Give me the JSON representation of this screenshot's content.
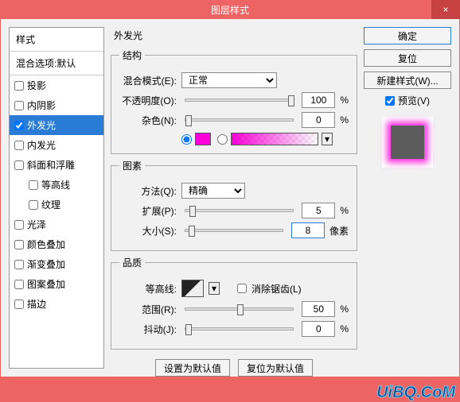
{
  "title": "图层样式",
  "close_glyph": "×",
  "left": {
    "header": "样式",
    "blend_row": "混合选项:默认",
    "items": [
      {
        "label": "投影",
        "checked": false,
        "selected": false,
        "indent": false
      },
      {
        "label": "内阴影",
        "checked": false,
        "selected": false,
        "indent": false
      },
      {
        "label": "外发光",
        "checked": true,
        "selected": true,
        "indent": false
      },
      {
        "label": "内发光",
        "checked": false,
        "selected": false,
        "indent": false
      },
      {
        "label": "斜面和浮雕",
        "checked": false,
        "selected": false,
        "indent": false
      },
      {
        "label": "等高线",
        "checked": false,
        "selected": false,
        "indent": true
      },
      {
        "label": "纹理",
        "checked": false,
        "selected": false,
        "indent": true
      },
      {
        "label": "光泽",
        "checked": false,
        "selected": false,
        "indent": false
      },
      {
        "label": "颜色叠加",
        "checked": false,
        "selected": false,
        "indent": false
      },
      {
        "label": "渐变叠加",
        "checked": false,
        "selected": false,
        "indent": false
      },
      {
        "label": "图案叠加",
        "checked": false,
        "selected": false,
        "indent": false
      },
      {
        "label": "描边",
        "checked": false,
        "selected": false,
        "indent": false
      }
    ]
  },
  "mid": {
    "title": "外发光",
    "structure": {
      "legend": "结构",
      "blend_label": "混合模式(E):",
      "blend_value": "正常",
      "opacity_label": "不透明度(O):",
      "opacity_value": "100",
      "opacity_unit": "%",
      "noise_label": "杂色(N):",
      "noise_value": "0",
      "noise_unit": "%",
      "color_hex": "#ff00dd"
    },
    "elements": {
      "legend": "图素",
      "technique_label": "方法(Q):",
      "technique_value": "精确",
      "spread_label": "扩展(P):",
      "spread_value": "5",
      "spread_unit": "%",
      "size_label": "大小(S):",
      "size_value": "8",
      "size_unit": "像素"
    },
    "quality": {
      "legend": "品质",
      "contour_label": "等高线:",
      "antialias_label": "消除锯齿(L)",
      "range_label": "范围(R):",
      "range_value": "50",
      "range_unit": "%",
      "jitter_label": "抖动(J):",
      "jitter_value": "0",
      "jitter_unit": "%"
    },
    "btns": {
      "set_default": "设置为默认值",
      "reset_default": "复位为默认值"
    }
  },
  "right": {
    "ok": "确定",
    "cancel": "复位",
    "new_style": "新建样式(W)...",
    "preview_label": "预览(V)",
    "preview_checked": true
  },
  "watermark": "UiBQ.CoM"
}
